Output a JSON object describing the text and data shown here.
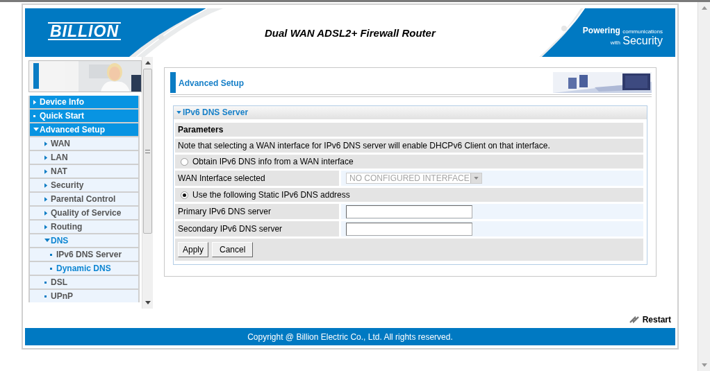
{
  "header": {
    "logo": "BILLION",
    "title": "Dual WAN ADSL2+ Firewall Router",
    "slogan_big": "Powering",
    "slogan_small": "communications",
    "slogan_with": "with",
    "slogan_word": "Security"
  },
  "sidebar": {
    "items": [
      {
        "label": "Device Info",
        "kind": "branch",
        "expanded": false
      },
      {
        "label": "Quick Start",
        "kind": "leaf"
      },
      {
        "label": "Advanced Setup",
        "kind": "branch",
        "expanded": true,
        "children": [
          {
            "label": "WAN",
            "kind": "branch",
            "expanded": false
          },
          {
            "label": "LAN",
            "kind": "branch",
            "expanded": false
          },
          {
            "label": "NAT",
            "kind": "branch",
            "expanded": false
          },
          {
            "label": "Security",
            "kind": "branch",
            "expanded": false
          },
          {
            "label": "Parental Control",
            "kind": "branch",
            "expanded": false
          },
          {
            "label": "Quality of Service",
            "kind": "branch",
            "expanded": false
          },
          {
            "label": "Routing",
            "kind": "branch",
            "expanded": false
          },
          {
            "label": "DNS",
            "kind": "branch",
            "expanded": true,
            "children": [
              {
                "label": "IPv6 DNS Server",
                "kind": "leaf",
                "selected": false
              },
              {
                "label": "Dynamic DNS",
                "kind": "leaf",
                "selected": true
              }
            ]
          },
          {
            "label": "DSL",
            "kind": "leaf"
          },
          {
            "label": "UPnP",
            "kind": "leaf"
          }
        ]
      }
    ]
  },
  "page": {
    "title": "Advanced Setup"
  },
  "panel": {
    "title": "IPv6 DNS Server",
    "expanded": true,
    "section": "Parameters",
    "note": "Note that selecting a WAN interface for IPv6 DNS server will enable DHCPv6 Client on that interface.",
    "rows": [
      {
        "kind": "radio",
        "label": "Obtain IPv6 DNS info from a WAN interface",
        "selected": false
      },
      {
        "kind": "select",
        "label": "WAN Interface selected",
        "value": "NO CONFIGURED INTERFACE",
        "disabled": true
      },
      {
        "kind": "radio",
        "label": "Use the following Static IPv6 DNS address",
        "selected": true
      },
      {
        "kind": "text",
        "label": "Primary IPv6 DNS server"
      },
      {
        "kind": "text",
        "label": "Secondary IPv6 DNS server"
      }
    ],
    "buttons": [
      "Apply",
      "Cancel"
    ]
  },
  "restart": "Restart",
  "footer": "Copyright @ Billion Electric Co., Ltd. All rights reserved."
}
